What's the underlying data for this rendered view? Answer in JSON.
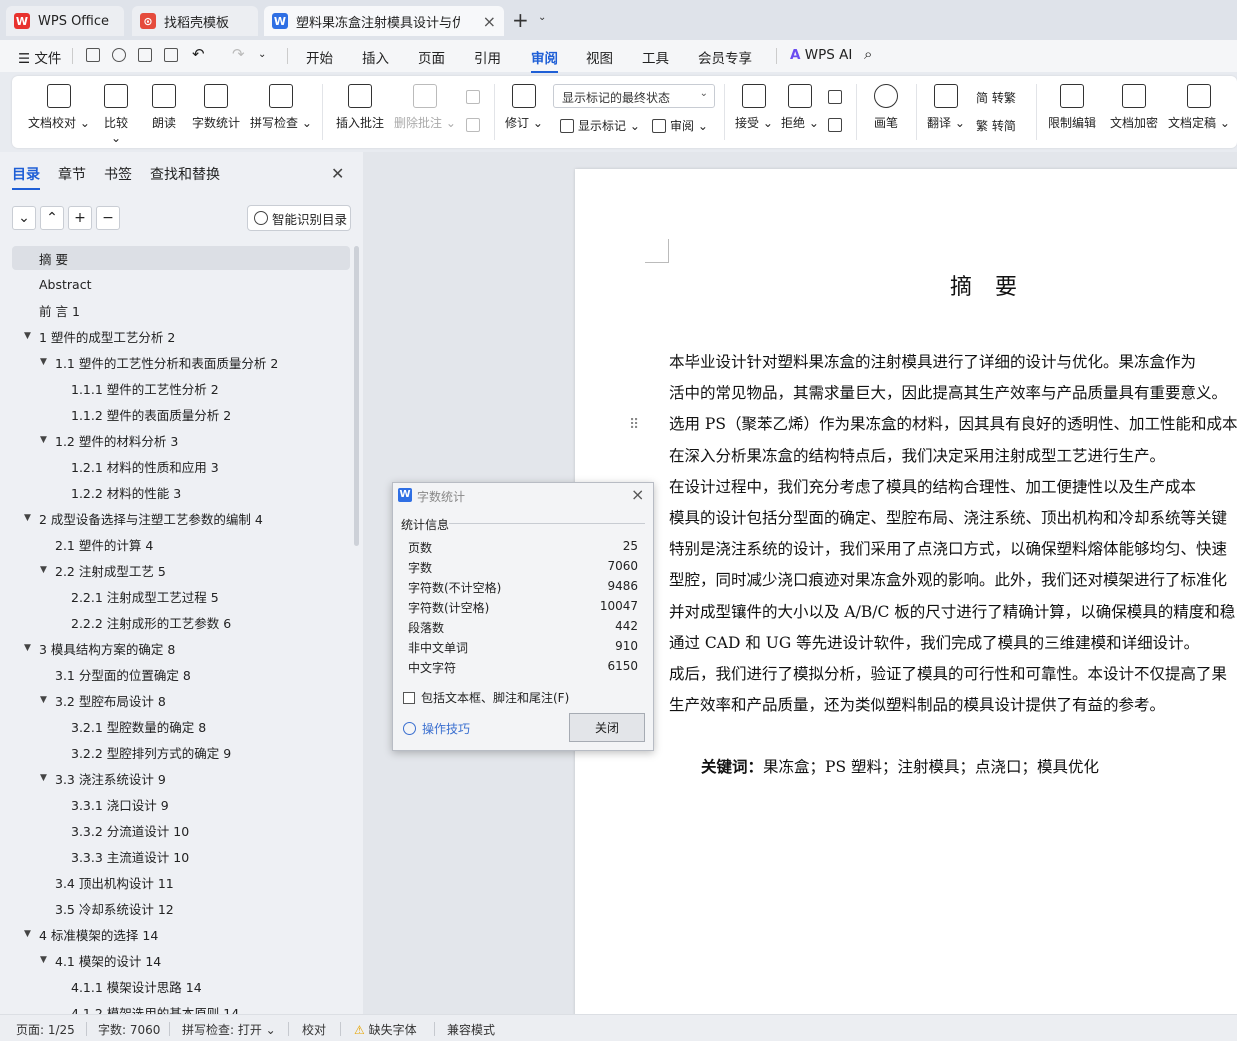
{
  "tabs": {
    "wps": "WPS Office",
    "templates": "找稻壳模板",
    "doc": "塑料果冻盒注射模具设计与优化"
  },
  "menu": {
    "file": "文件",
    "items": [
      "开始",
      "插入",
      "页面",
      "引用",
      "审阅",
      "视图",
      "工具",
      "会员专享"
    ],
    "ai": "WPS AI"
  },
  "ribbon": {
    "proofread": "文档校对",
    "compare": "比较",
    "read_aloud": "朗读",
    "word_count": "字数统计",
    "spell_check": "拼写检查",
    "insert_comment": "插入批注",
    "delete_comment": "删除批注",
    "track": "修订",
    "markup_state": "显示标记的最终状态",
    "show_markup": "显示标记",
    "review": "审阅",
    "accept": "接受",
    "reject": "拒绝",
    "pen": "画笔",
    "translate": "翻译",
    "to_traditional": "简 转繁",
    "to_simplified": "繁 转简",
    "restrict_edit": "限制编辑",
    "encrypt": "文档加密",
    "finalize": "文档定稿"
  },
  "sidebar": {
    "tabs": [
      "目录",
      "章节",
      "书签",
      "查找和替换"
    ],
    "smart_toc": "智能识别目录",
    "toc": [
      {
        "text": "摘  要",
        "level": 0
      },
      {
        "text": "Abstract",
        "level": 0
      },
      {
        "text": "前    言 1",
        "level": 0
      },
      {
        "text": "1 塑件的成型工艺分析  2",
        "level": 1
      },
      {
        "text": "1.1  塑件的工艺性分析和表面质量分析  2",
        "level": 2
      },
      {
        "text": "1.1.1  塑件的工艺性分析  2",
        "level": 3
      },
      {
        "text": "1.1.2  塑件的表面质量分析  2",
        "level": 3
      },
      {
        "text": "1.2  塑件的材料分析  3",
        "level": 2
      },
      {
        "text": "1.2.1  材料的性质和应用  3",
        "level": 3
      },
      {
        "text": "1.2.2 材料的性能  3",
        "level": 3
      },
      {
        "text": "2  成型设备选择与注塑工艺参数的编制  4",
        "level": 1
      },
      {
        "text": "2.1  塑件的计算  4",
        "level": 2
      },
      {
        "text": "2.2  注射成型工艺  5",
        "level": 2
      },
      {
        "text": "2.2.1  注射成型工艺过程  5",
        "level": 3
      },
      {
        "text": "2.2.2  注射成形的工艺参数  6",
        "level": 3
      },
      {
        "text": "3  模具结构方案的确定  8",
        "level": 1
      },
      {
        "text": "3.1  分型面的位置确定  8",
        "level": 2
      },
      {
        "text": "3.2  型腔布局设计  8",
        "level": 2
      },
      {
        "text": "3.2.1  型腔数量的确定  8",
        "level": 3
      },
      {
        "text": "3.2.2  型腔排列方式的确定  9",
        "level": 3
      },
      {
        "text": "3.3  浇注系统设计  9",
        "level": 2
      },
      {
        "text": "3.3.1  浇口设计  9",
        "level": 3
      },
      {
        "text": "3.3.2  分流道设计  10",
        "level": 3
      },
      {
        "text": "3.3.3  主流道设计  10",
        "level": 3
      },
      {
        "text": "3.4  顶出机构设计  11",
        "level": 2
      },
      {
        "text": "3.5  冷却系统设计  12",
        "level": 2
      },
      {
        "text": "4  标准模架的选择  14",
        "level": 1
      },
      {
        "text": "4.1 模架的设计  14",
        "level": 2
      },
      {
        "text": "4.1.1  模架设计思路  14",
        "level": 3
      },
      {
        "text": "4.1.2  模架选用的基本原则  14",
        "level": 3
      }
    ]
  },
  "document": {
    "title": "摘 要",
    "lines": [
      "        本毕业设计针对塑料果冻盒的注射模具进行了详细的设计与优化。果冻盒作为",
      "活中的常见物品，其需求量巨大，因此提高其生产效率与产品质量具有重要意义。",
      "选用 PS（聚苯乙烯）作为果冻盒的材料，因其具有良好的透明性、加工性能和成本",
      "在深入分析果冻盒的结构特点后，我们决定采用注射成型工艺进行生产。",
      "        在设计过程中，我们充分考虑了模具的结构合理性、加工便捷性以及生产成本",
      "模具的设计包括分型面的确定、型腔布局、浇注系统、顶出机构和冷却系统等关键",
      "特别是浇注系统的设计，我们采用了点浇口方式，以确保塑料熔体能够均匀、快速",
      "型腔，同时减少浇口痕迹对果冻盒外观的影响。此外，我们还对模架进行了标准化",
      "并对成型镶件的大小以及 A/B/C 板的尺寸进行了精确计算，以确保模具的精度和稳",
      "        通过 CAD 和 UG 等先进设计软件，我们完成了模具的三维建模和详细设计。",
      "成后，我们进行了模拟分析，验证了模具的可行性和可靠性。本设计不仅提高了果",
      "生产效率和产品质量，还为类似塑料制品的模具设计提供了有益的参考。"
    ],
    "keywords_label": "关键词：",
    "keywords": "果冻盒；PS 塑料；注射模具；点浇口；模具优化"
  },
  "word_count_dialog": {
    "title": "字数统计",
    "section": "统计信息",
    "rows": [
      {
        "label": "页数",
        "value": "25"
      },
      {
        "label": "字数",
        "value": "7060"
      },
      {
        "label": "字符数(不计空格)",
        "value": "9486"
      },
      {
        "label": "字符数(计空格)",
        "value": "10047"
      },
      {
        "label": "段落数",
        "value": "442"
      },
      {
        "label": "非中文单词",
        "value": "910"
      },
      {
        "label": "中文字符",
        "value": "6150"
      }
    ],
    "include_label": "包括文本框、脚注和尾注(F)",
    "tips": "操作技巧",
    "close": "关闭"
  },
  "status": {
    "page": "页面: 1/25",
    "words": "字数: 7060",
    "spell": "拼写检查: 打开",
    "proof": "校对",
    "missing_font": "缺失字体",
    "compat": "兼容模式"
  },
  "colors": {
    "accent": "#1f5fd6",
    "wps_red": "#e8322e"
  }
}
